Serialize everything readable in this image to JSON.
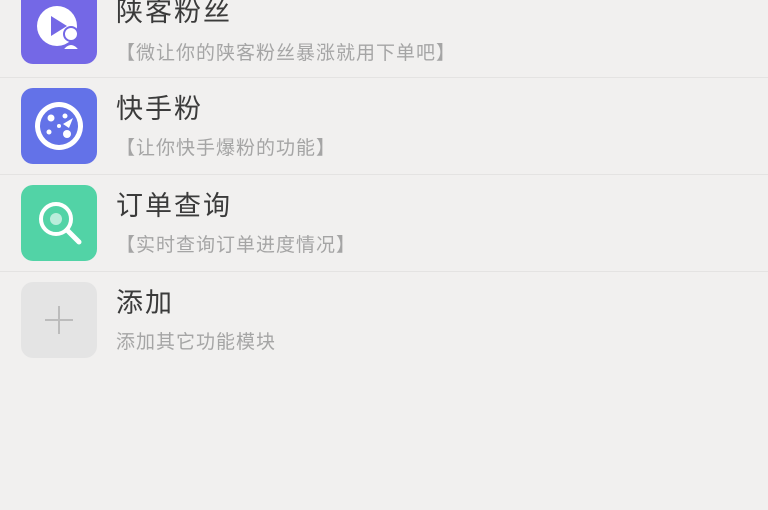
{
  "features": [
    {
      "title": "陕客粉丝",
      "description": "【微让你的陕客粉丝暴涨就用下单吧】",
      "icon": "play-user-icon",
      "color": "#7468e6"
    },
    {
      "title": "快手粉",
      "description": "【让你快手爆粉的功能】",
      "icon": "sparkle-dots-icon",
      "color": "#6372e8"
    },
    {
      "title": "订单查询",
      "description": "【实时查询订单进度情况】",
      "icon": "search-icon",
      "color": "#52d3a6"
    },
    {
      "title": "添加",
      "description": "添加其它功能模块",
      "icon": "plus-icon",
      "color": "#e4e4e4"
    }
  ]
}
